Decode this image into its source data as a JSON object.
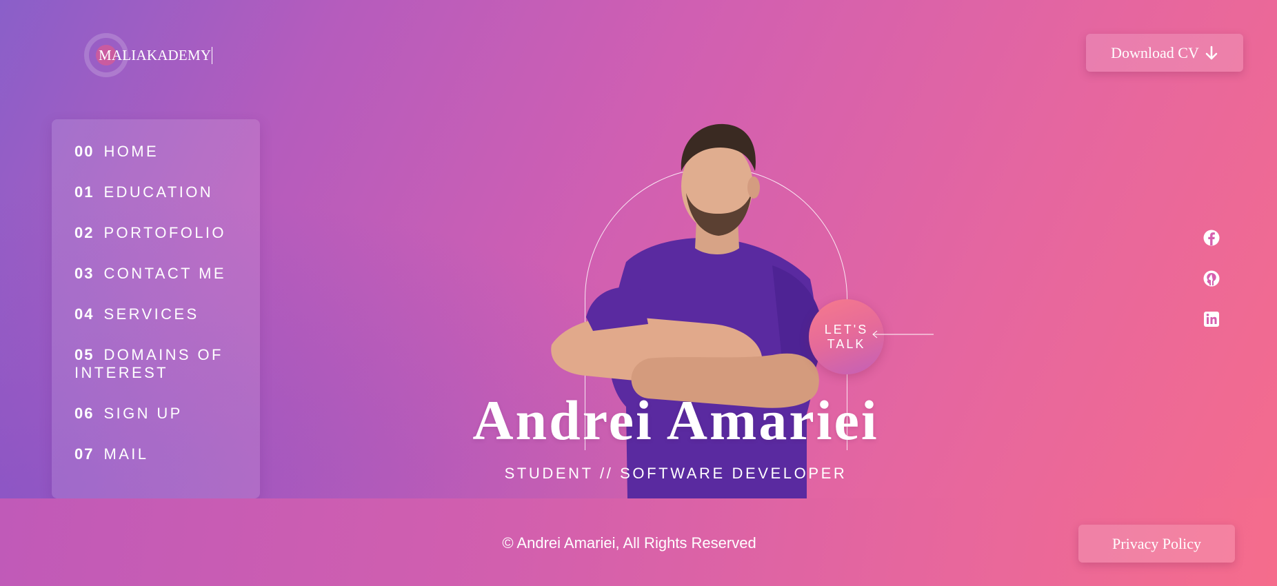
{
  "brand": {
    "logo_text": "MALIAKADEMY"
  },
  "header": {
    "download_cv_label": "Download CV",
    "download_icon": "arrow-down-icon"
  },
  "nav": {
    "items": [
      {
        "num": "00",
        "label": "HOME"
      },
      {
        "num": "01",
        "label": "EDUCATION"
      },
      {
        "num": "02",
        "label": "PORTOFOLIO"
      },
      {
        "num": "03",
        "label": "CONTACT ME"
      },
      {
        "num": "04",
        "label": "SERVICES"
      },
      {
        "num": "05",
        "label": "DOMAINS OF INTEREST"
      },
      {
        "num": "06",
        "label": "SIGN UP"
      },
      {
        "num": "07",
        "label": "MAIL"
      }
    ]
  },
  "hero": {
    "name": "Andrei Amariei",
    "subtitle": "STUDENT // SOFTWARE DEVELOPER",
    "cta_line1": "LET'S",
    "cta_line2": "TALK",
    "shirt_color": "#5a2aa0"
  },
  "social": {
    "icons": [
      "facebook-icon",
      "github-icon",
      "linkedin-icon"
    ]
  },
  "footer": {
    "copyright": "© Andrei Amariei, All Rights Reserved",
    "privacy_label": "Privacy Policy"
  },
  "colors": {
    "gradient_start": "#8a5fc9",
    "gradient_mid": "#d05fb2",
    "gradient_end": "#f56c8c"
  }
}
